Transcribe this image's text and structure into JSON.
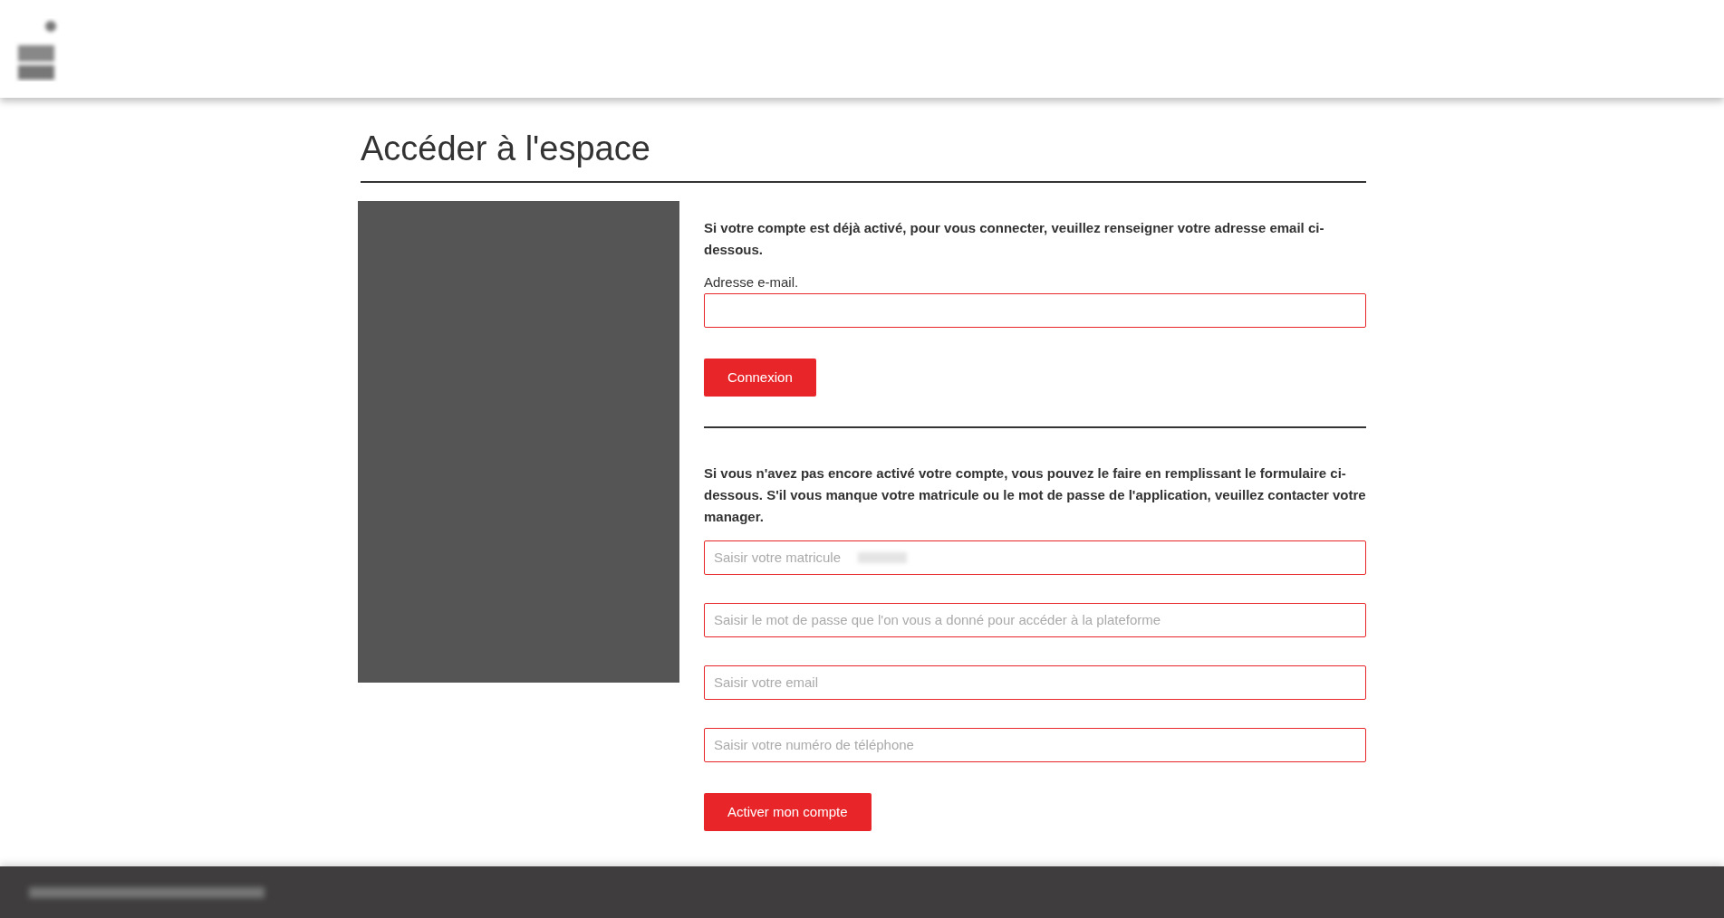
{
  "page": {
    "title": "Accéder à l'espace"
  },
  "login": {
    "intro": "Si votre compte est déjà activé, pour vous connecter, veuillez renseigner votre adresse email ci-dessous.",
    "email_label": "Adresse e-mail.",
    "button": "Connexion"
  },
  "activation": {
    "intro": "Si vous n'avez pas encore activé votre compte, vous pouvez le faire en remplissant le formulaire ci-dessous. S'il vous manque votre matricule ou le mot de passe de l'application, veuillez contacter votre manager.",
    "fields": [
      {
        "placeholder": "Saisir votre matricule",
        "redacted_suffix": true
      },
      {
        "placeholder": "Saisir le mot de passe que l'on vous a donné pour accéder à la plateforme",
        "redacted_suffix": false
      },
      {
        "placeholder": "Saisir votre email",
        "redacted_suffix": false
      },
      {
        "placeholder": "Saisir votre numéro de téléphone",
        "redacted_suffix": false
      }
    ],
    "button": "Activer mon compte"
  }
}
